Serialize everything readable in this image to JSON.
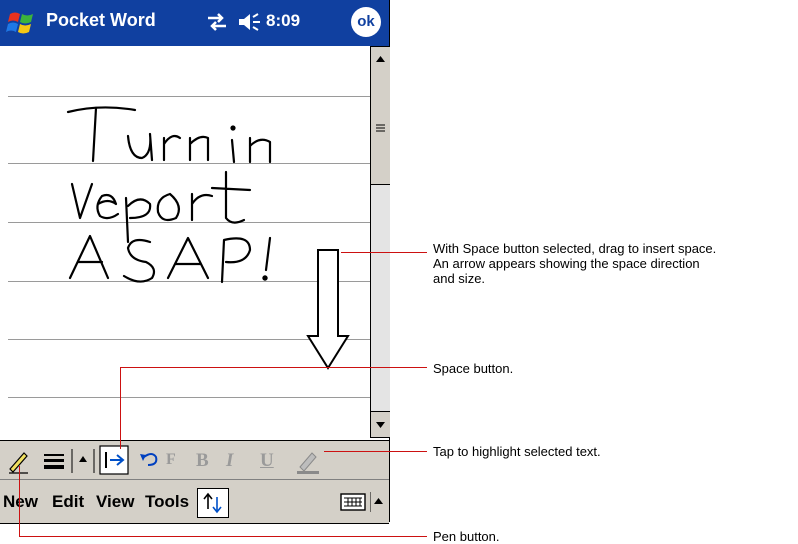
{
  "titlebar": {
    "app_title": "Pocket Word",
    "time": "8:09",
    "ok_label": "ok",
    "icons": [
      "windows-flag-icon",
      "connectivity-icon",
      "volume-icon"
    ]
  },
  "document": {
    "handwritten_lines": [
      "Turn in",
      "report",
      "ASAP!"
    ]
  },
  "toolbar": {
    "buttons": [
      "pen-icon",
      "line-weight-icon",
      "dropdown-arrow-icon",
      "space-icon",
      "undo-icon",
      "font-icon",
      "bold-icon",
      "italic-icon",
      "underline-icon",
      "highlight-icon"
    ],
    "bold": "B",
    "italic": "I",
    "underline": "U",
    "font_glyph": "F"
  },
  "menubar": {
    "new": "New",
    "edit": "Edit",
    "view": "View",
    "tools": "Tools"
  },
  "callouts": {
    "space_drag_line1": "With Space button selected, drag to insert space.",
    "space_drag_line2": "An arrow appears showing the space direction",
    "space_drag_line3": "and size.",
    "space_button": "Space button.",
    "highlight": "Tap to highlight selected text.",
    "pen_button": "Pen button."
  },
  "colors": {
    "titlebar": "#1040a0",
    "callout_line": "#cc1111",
    "chrome": "#d4d0c8"
  }
}
